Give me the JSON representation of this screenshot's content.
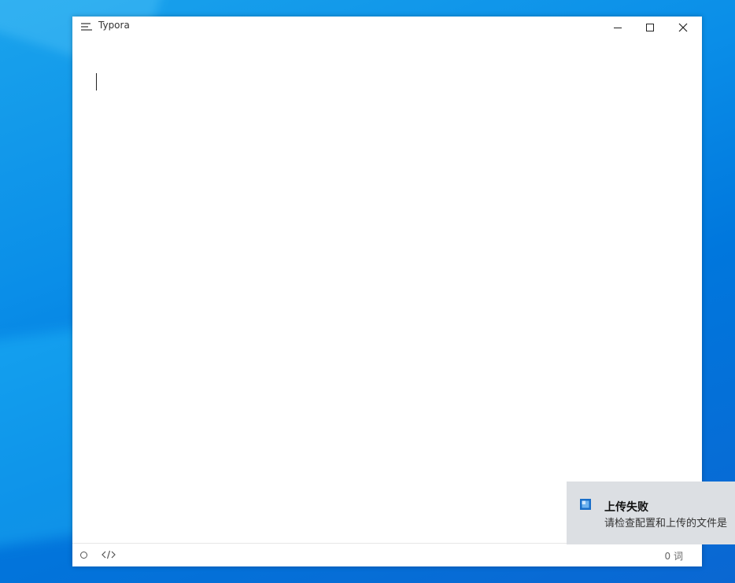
{
  "window": {
    "title": "Typora",
    "controls": {
      "minimize_icon": "minimize-icon",
      "maximize_icon": "maximize-icon",
      "close_icon": "close-icon"
    }
  },
  "statusbar": {
    "word_count": "0 词"
  },
  "notification": {
    "title": "上传失败",
    "message": "请检查配置和上传的文件是"
  },
  "colors": {
    "desktop_accent": "#0a8ee8",
    "toast_background": "#dcdfe3",
    "toast_icon": "#1a6fc9"
  }
}
